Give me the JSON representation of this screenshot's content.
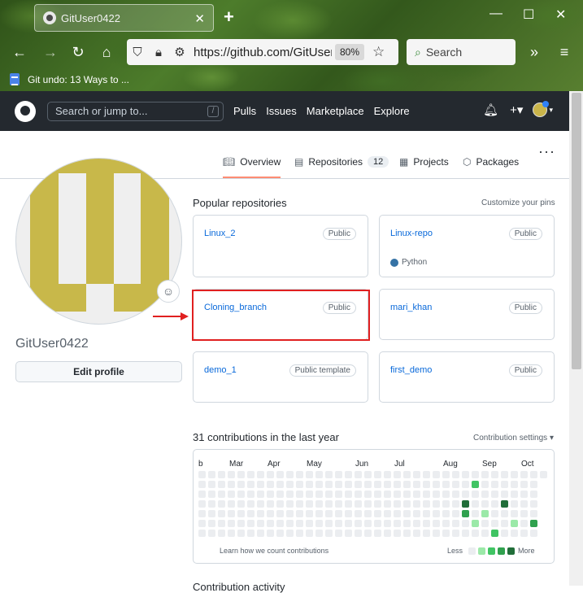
{
  "browser": {
    "tab_title": "GitUser0422",
    "url": "https://github.com/GitUser0422",
    "zoom": "80%",
    "search_placeholder": "Search",
    "bookmark": "Git undo: 13 Ways to ..."
  },
  "header": {
    "search_placeholder": "Search or jump to...",
    "slash": "/",
    "nav": [
      "Pulls",
      "Issues",
      "Marketplace",
      "Explore"
    ]
  },
  "tabs": {
    "overview": "Overview",
    "repositories": "Repositories",
    "repositories_count": "12",
    "projects": "Projects",
    "packages": "Packages"
  },
  "profile": {
    "username": "GitUser0422",
    "edit_label": "Edit profile"
  },
  "popular": {
    "title": "Popular repositories",
    "customize": "Customize your pins",
    "repos": [
      {
        "name": "Linux_2",
        "visibility": "Public",
        "language": ""
      },
      {
        "name": "Linux-repo",
        "visibility": "Public",
        "language": "Python"
      },
      {
        "name": "Cloning_branch",
        "visibility": "Public",
        "language": ""
      },
      {
        "name": "mari_khan",
        "visibility": "Public",
        "language": ""
      },
      {
        "name": "demo_1",
        "visibility": "Public template",
        "language": ""
      },
      {
        "name": "first_demo",
        "visibility": "Public",
        "language": ""
      }
    ]
  },
  "contributions": {
    "title": "31 contributions in the last year",
    "settings": "Contribution settings ▾",
    "months": [
      "b",
      "Mar",
      "Apr",
      "May",
      "Jun",
      "Jul",
      "Aug",
      "Sep",
      "Oct"
    ],
    "learn": "Learn how we count contributions",
    "less": "Less",
    "more": "More",
    "colors": [
      "#ebedf0",
      "#9be9a8",
      "#40c463",
      "#30a14e",
      "#216e39"
    ]
  },
  "next_section": "Contribution activity"
}
